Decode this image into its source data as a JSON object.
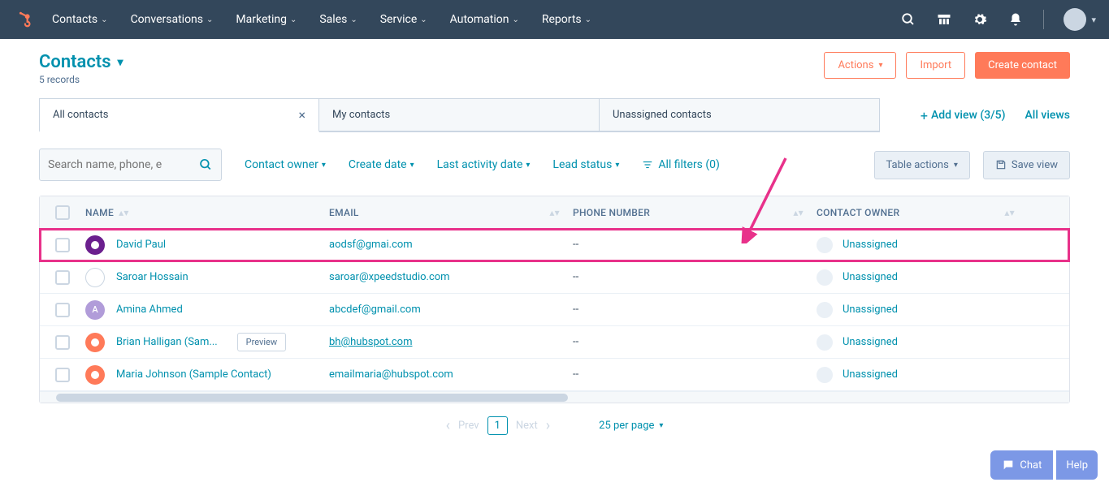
{
  "nav": [
    "Contacts",
    "Conversations",
    "Marketing",
    "Sales",
    "Service",
    "Automation",
    "Reports"
  ],
  "page_title": "Contacts",
  "record_count": "5 records",
  "actions": {
    "actions": "Actions",
    "import": "Import",
    "create": "Create contact"
  },
  "tabs": [
    {
      "label": "All contacts",
      "active": true,
      "closable": true
    },
    {
      "label": "My contacts",
      "active": false,
      "closable": false
    },
    {
      "label": "Unassigned contacts",
      "active": false,
      "closable": false
    }
  ],
  "add_view": "Add view (3/5)",
  "all_views": "All views",
  "search_placeholder": "Search name, phone, e",
  "filters": {
    "owner": "Contact owner",
    "create": "Create date",
    "activity": "Last activity date",
    "lead": "Lead status",
    "all": "All filters (0)",
    "table_actions": "Table actions",
    "save_view": "Save view"
  },
  "columns": {
    "name": "NAME",
    "email": "EMAIL",
    "phone": "PHONE NUMBER",
    "owner": "CONTACT OWNER"
  },
  "rows": [
    {
      "name": "David Paul",
      "email": "aodsf@gmai.com",
      "phone": "--",
      "owner": "Unassigned",
      "avatar_bg": "#6b1f8e",
      "avatar_txt": "",
      "highlighted": true,
      "preview": false,
      "email_underline": false
    },
    {
      "name": "Saroar Hossain",
      "email": "saroar@xpeedstudio.com",
      "phone": "--",
      "owner": "Unassigned",
      "avatar_bg": "#ffffff",
      "avatar_txt": "",
      "highlighted": false,
      "preview": false,
      "email_underline": false
    },
    {
      "name": "Amina Ahmed",
      "email": "abcdef@gmail.com",
      "phone": "--",
      "owner": "Unassigned",
      "avatar_bg": "#b19cd9",
      "avatar_txt": "A",
      "highlighted": false,
      "preview": false,
      "email_underline": false
    },
    {
      "name": "Brian Halligan (Sam...",
      "email": "bh@hubspot.com",
      "phone": "--",
      "owner": "Unassigned",
      "avatar_bg": "#ff7a59",
      "avatar_txt": "",
      "highlighted": false,
      "preview": true,
      "email_underline": true
    },
    {
      "name": "Maria Johnson (Sample Contact)",
      "email": "emailmaria@hubspot.com",
      "phone": "--",
      "owner": "Unassigned",
      "avatar_bg": "#ff7a59",
      "avatar_txt": "",
      "highlighted": false,
      "preview": false,
      "email_underline": false
    }
  ],
  "preview_label": "Preview",
  "pager": {
    "prev": "Prev",
    "page": "1",
    "next": "Next",
    "perpage": "25 per page"
  },
  "float": {
    "chat": "Chat",
    "help": "Help"
  }
}
